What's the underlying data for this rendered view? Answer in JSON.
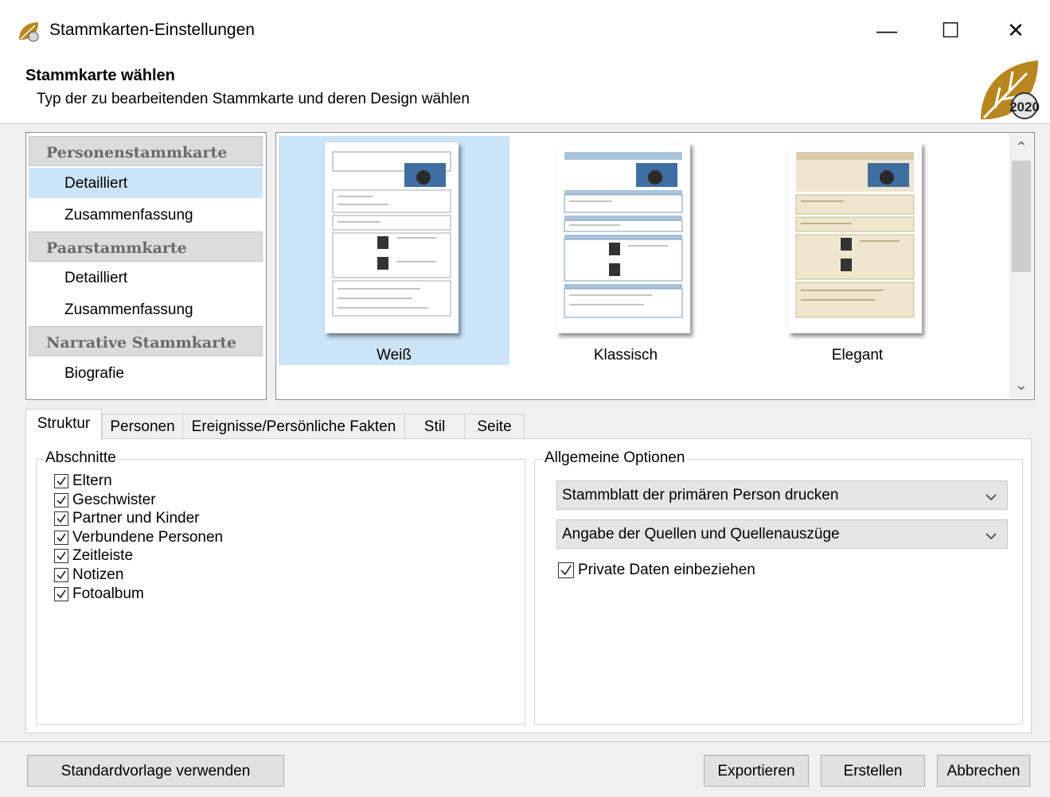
{
  "window": {
    "title": "Stammkarten-Einstellungen",
    "minimize": "—",
    "maximize": "☐",
    "close": "✕"
  },
  "header": {
    "title": "Stammkarte wählen",
    "subtitle": "Typ der zu bearbeitenden Stammkarte und deren Design wählen",
    "logo_text": "2020"
  },
  "card_types": [
    {
      "group": "Personenstammkarte",
      "items": [
        "Detailliert",
        "Zusammenfassung"
      ]
    },
    {
      "group": "Paarstammkarte",
      "items": [
        "Detailliert",
        "Zusammenfassung"
      ]
    },
    {
      "group": "Narrative Stammkarte",
      "items": [
        "Biografie"
      ]
    }
  ],
  "selected_card_type": "Personenstammkarte / Detailliert",
  "designs": [
    {
      "label": "Weiß",
      "selected": true,
      "style": "white"
    },
    {
      "label": "Klassisch",
      "selected": false,
      "style": "classic"
    },
    {
      "label": "Elegant",
      "selected": false,
      "style": "elegant"
    }
  ],
  "tabs": [
    "Struktur",
    "Personen",
    "Ereignisse/Persönliche Fakten",
    "Stil",
    "Seite"
  ],
  "active_tab": "Struktur",
  "sections": {
    "title": "Abschnitte",
    "items": [
      {
        "label": "Eltern",
        "checked": true
      },
      {
        "label": "Geschwister",
        "checked": true
      },
      {
        "label": "Partner und Kinder",
        "checked": true
      },
      {
        "label": "Verbundene Personen",
        "checked": true
      },
      {
        "label": "Zeitleiste",
        "checked": true
      },
      {
        "label": "Notizen",
        "checked": true
      },
      {
        "label": "Fotoalbum",
        "checked": true
      }
    ]
  },
  "general_options": {
    "title": "Allgemeine Optionen",
    "dropdown1": "Stammblatt der primären Person drucken",
    "dropdown2": "Angabe der Quellen und Quellenauszüge",
    "private_data_label": "Private Daten einbeziehen",
    "private_data_checked": true
  },
  "footer": {
    "default_template": "Standardvorlage verwenden",
    "export": "Exportieren",
    "create": "Erstellen",
    "cancel": "Abbrechen"
  },
  "colors": {
    "selection": "#cce4f7",
    "group_bg": "#dcdcdc",
    "logo_gold": "#b8861f"
  }
}
